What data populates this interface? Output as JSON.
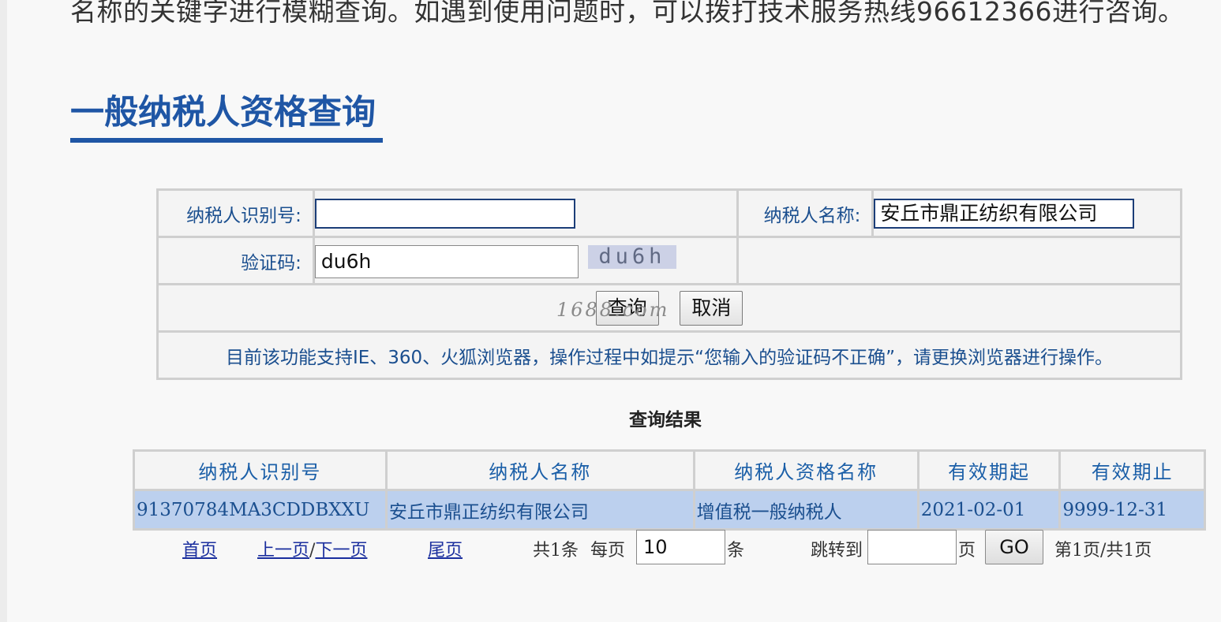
{
  "intro_text": "名称的关键字进行模糊查询。如遇到使用问题时，可以拨打技术服务热线96612366进行咨询。",
  "section_title": "一般纳税人资格查询",
  "form": {
    "taxpayer_id_label": "纳税人识别号:",
    "taxpayer_id_value": "",
    "taxpayer_name_label": "纳税人名称:",
    "taxpayer_name_value": "安丘市鼎正纺织有限公司",
    "captcha_label": "验证码:",
    "captcha_value": "du6h",
    "captcha_image_text": "du6h",
    "query_button": "查询",
    "cancel_button": "取消",
    "watermark": "1688.com",
    "notice": "目前该功能支持IE、360、火狐浏览器，操作过程中如提示“您输入的验证码不正确”，请更换浏览器进行操作。"
  },
  "results": {
    "title": "查询结果",
    "headers": [
      "纳税人识别号",
      "纳税人名称",
      "纳税人资格名称",
      "有效期起",
      "有效期止"
    ],
    "rows": [
      [
        "91370784MA3CDDBXXU",
        "安丘市鼎正纺织有限公司",
        "增值税一般纳税人",
        "2021-02-01",
        "9999-12-31"
      ]
    ]
  },
  "pager": {
    "first": "首页",
    "prev": "上一页",
    "sep": "/",
    "next": "下一页",
    "last": "尾页",
    "total": "共1条",
    "per_page_label": "每页",
    "per_page_value": "10",
    "per_page_unit": "条",
    "jump_label": "跳转到",
    "jump_value": "",
    "page_unit": "页",
    "go_button": "GO",
    "page_info": "第1页/共1页"
  },
  "colors": {
    "accent": "#1f56a5",
    "row_highlight": "#bcd0ee"
  }
}
